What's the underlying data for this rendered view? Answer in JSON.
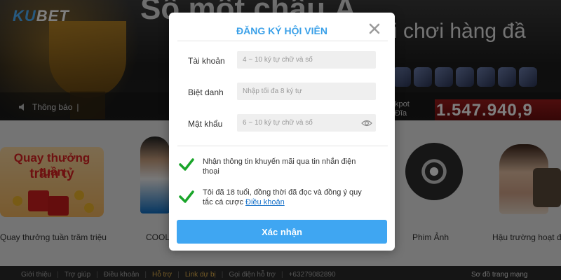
{
  "background": {
    "logo": {
      "ku": "KU",
      "bet": "BET"
    },
    "hero_text": "i chơi hàng đầ",
    "hero_top_text": "Số một châu Á",
    "notice": {
      "label": "Thông báo",
      "separator": "|"
    },
    "jackpot": {
      "label_1": "kpot",
      "label_2": "Đĩa",
      "value": "1.547.940,9"
    },
    "promo_card": {
      "line1": "Quay thưởng tuần",
      "line2": "trăm tỷ"
    },
    "captions": {
      "weekly_spin": "Quay thưởng tuần trăm triệu",
      "cool": "COOL-",
      "movies": "Phim Ảnh",
      "backstage": "Hậu trường hoạt độ"
    },
    "footer": {
      "links": [
        "Giới thiệu",
        "Trợ giúp",
        "Điều khoản",
        "Hỗ trợ",
        "Link dự bị",
        "Gọi điện hỗ trợ",
        "+63279082890"
      ],
      "highlighted": [
        "Hỗ trợ",
        "Link dự bị"
      ],
      "right": "Sơ đồ trang mạng"
    }
  },
  "modal": {
    "title": "ĐĂNG KÝ HỘI VIÊN",
    "fields": {
      "account": {
        "label": "Tài khoản",
        "value": "",
        "placeholder": "4 ~ 10 ký tự chữ và số"
      },
      "nickname": {
        "label": "Biệt danh",
        "value": "",
        "placeholder": "Nhập tối đa 8 ký tự"
      },
      "password": {
        "label": "Mật khẩu",
        "value": "",
        "placeholder": "6 ~ 10 ký tự chữ và số"
      }
    },
    "checkboxes": {
      "promo": {
        "text": "Nhận thông tin khuyến mãi qua tin nhắn điện thoại",
        "checked": true
      },
      "terms": {
        "text": "Tôi đã 18 tuổi, đồng thời đã đọc và đồng ý quy tắc cá cược",
        "link": "Điều khoản",
        "checked": true
      }
    },
    "submit_label": "Xác nhận"
  },
  "colors": {
    "accent": "#3fa6f2",
    "title": "#3aa0e8",
    "check": "#1aa52a",
    "jackpot": "#8a1414"
  }
}
